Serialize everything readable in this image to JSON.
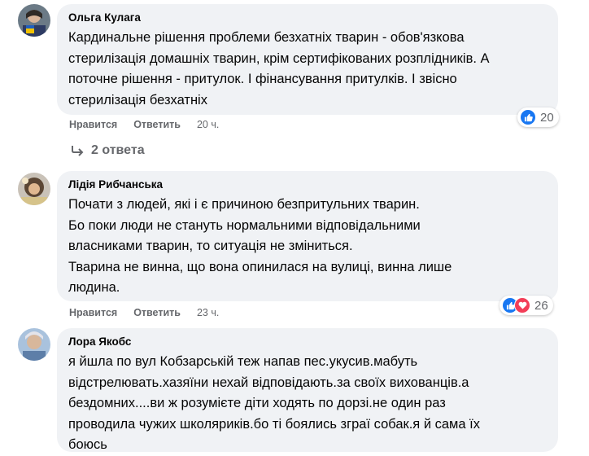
{
  "comments": [
    {
      "author": "Ольга Кулага",
      "text": "Кардинальне рішення проблеми безхатніх тварин - обов'язкова\nстерилізація домашніх тварин, крім сертифікованих розплідників. А\nпоточне рішення - притулок. І фінансування притулків. І звісно\nстерилізація безхатніх",
      "like_label": "Нравится",
      "reply_label": "Ответить",
      "time": "20 ч.",
      "reaction_count": "20",
      "replies_label": "2 ответа"
    },
    {
      "author": "Лідія Рибчанська",
      "text": "Почати з людей, які і є причиною безпритульних тварин.\nБо поки люди не стануть нормальними відповідальними\nвласниками тварин, то ситуація не зміниться.\nТварина не винна, що вона опинилася на вулиці, винна лише\nлюдина.",
      "like_label": "Нравится",
      "reply_label": "Ответить",
      "time": "23 ч.",
      "reaction_count": "26"
    },
    {
      "author": "Лора Якобс",
      "text": "я йшла по вул Кобзарській теж напав пес.укусив.мабуть\nвідстрелювать.хазяїни нехай відповідають.за своїх вихованців.а\nбездомних....ви ж розумієте діти ходять по дорзі.не один раз\nпроводила чужих школяриків.бо ті боялись зграї собак.я й сама їх\nбоюсь"
    }
  ],
  "colors": {
    "bubble": "#f0f2f5",
    "secondary_text": "#65676b",
    "like_blue": "#1877f2",
    "love_red": "#f33e58"
  }
}
